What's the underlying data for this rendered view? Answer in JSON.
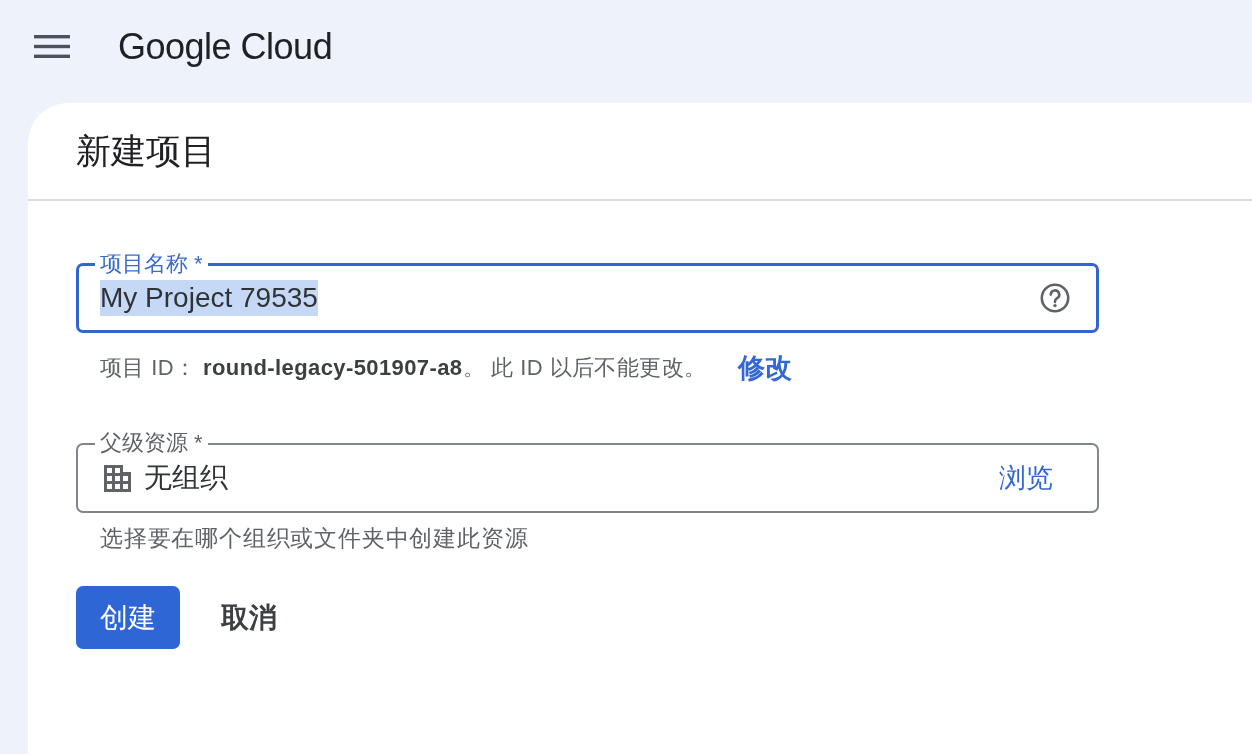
{
  "header": {
    "logo": "Google Cloud"
  },
  "page": {
    "title": "新建项目"
  },
  "form": {
    "fields": [
      {
        "kind": "text",
        "label": "项目名称 *",
        "value": "My Project 79535",
        "focused": true,
        "text_selected": true,
        "helper": "项目 ID： **round-legacy-501907-a8**。 此 ID 以后不能更改。",
        "link": "修改"
      },
      {
        "kind": "picker",
        "label": "父级资源 *",
        "value": "无组织",
        "focused": false,
        "text_selected": false,
        "action": "浏览",
        "helper": "选择要在哪个组织或文件夹中创建此资源"
      }
    ],
    "buttons": [
      {
        "kind": "primary",
        "label": "创建"
      },
      {
        "kind": "text",
        "label": "取消"
      }
    ]
  }
}
